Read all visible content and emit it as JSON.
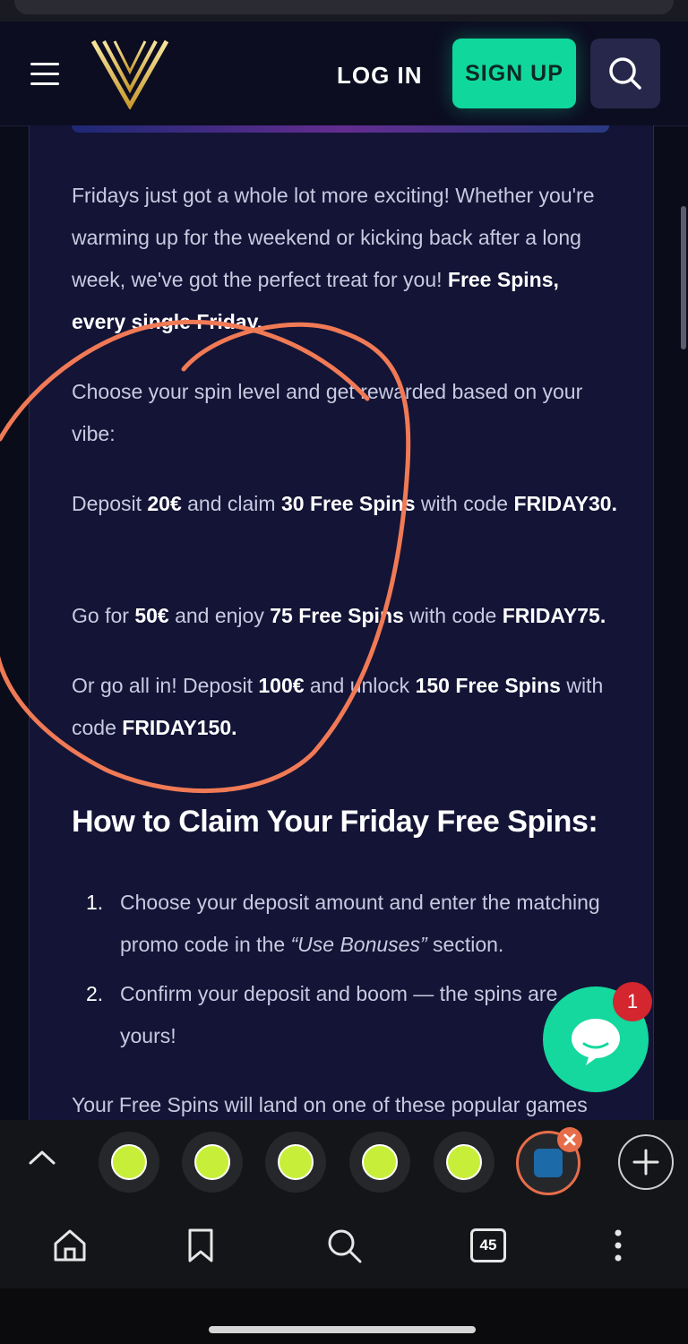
{
  "header": {
    "login_label": "LOG IN",
    "signup_label": "SIGN UP"
  },
  "content": {
    "intro_text": "Fridays just got a whole lot more exciting! Whether you're warming up for the weekend or kicking back after a long week, we've got the perfect treat for you!",
    "intro_bold": "Free Spins, every single Friday.",
    "choose_text": "Choose your spin level and get rewarded based on your vibe:",
    "tier1": {
      "pre": "Deposit ",
      "amount": "20€",
      "mid": " and claim ",
      "spins": "30 Free Spins",
      "post": " with code ",
      "code": "FRIDAY30."
    },
    "tier2": {
      "pre": "Go for ",
      "amount": "50€",
      "mid": " and enjoy ",
      "spins": "75 Free Spins",
      "post": " with code ",
      "code": "FRIDAY75."
    },
    "tier3": {
      "pre": "Or go all in! Deposit ",
      "amount": "100€",
      "mid": " and unlock ",
      "spins": "150 Free Spins",
      "post": " with code ",
      "code": "FRIDAY150."
    },
    "heading": "How to Claim Your Friday Free Spins:",
    "steps": [
      {
        "num": "1.",
        "pre": "Choose your deposit amount and enter the matching promo code in the ",
        "em": "“Use Bonuses”",
        "post": " section."
      },
      {
        "num": "2.",
        "text": "Confirm your deposit and boom — the spins are yours!"
      }
    ],
    "footer_text": "Your Free Spins will land on one of these popular games"
  },
  "chat": {
    "badge_count": "1"
  },
  "browser": {
    "tab_count": "45"
  },
  "colors": {
    "accent": "#10d89c",
    "annotation": "#f07a55",
    "background": "#131436"
  }
}
